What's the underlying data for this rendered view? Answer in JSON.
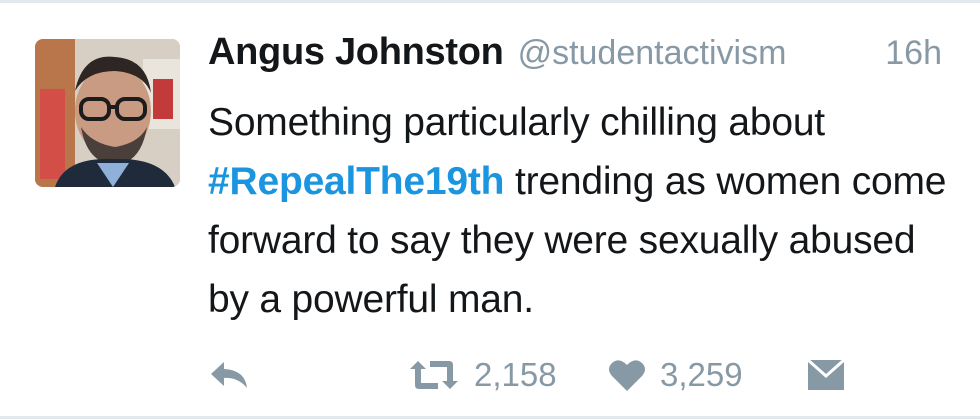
{
  "tweet": {
    "author_name": "Angus Johnston",
    "author_handle": "@studentactivism",
    "timestamp": "16h",
    "text_before": "Something particularly chilling about ",
    "hashtag": "#RepealThe19th",
    "text_after": " trending as women come forward to say they were sexually abused by a powerful man.",
    "retweet_count": "2,158",
    "like_count": "3,259"
  },
  "icons": {
    "reply": "reply-arrow-icon",
    "retweet": "retweet-icon",
    "like": "heart-icon",
    "message": "envelope-icon"
  },
  "colors": {
    "text": "#14171a",
    "secondary": "#8899a6",
    "link": "#1b95e0",
    "border": "#e3e8ec"
  }
}
